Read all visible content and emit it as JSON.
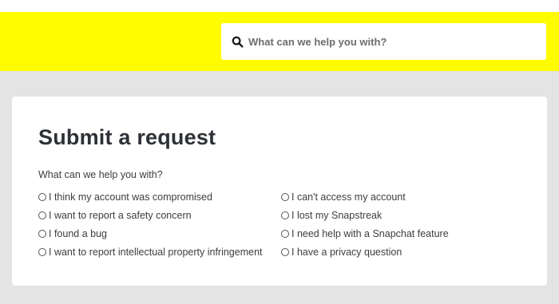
{
  "search": {
    "placeholder": "What can we help you with?",
    "icon": "search-icon"
  },
  "colors": {
    "header_yellow": "#fffc00",
    "page_background": "#e4e4e4",
    "title_text": "#2e3136"
  },
  "form": {
    "title": "Submit a request",
    "question": "What can we help you with?",
    "options": [
      {
        "label": "I think my account was compromised",
        "selected": false
      },
      {
        "label": "I can't access my account",
        "selected": false
      },
      {
        "label": "I want to report a safety concern",
        "selected": false
      },
      {
        "label": "I lost my Snapstreak",
        "selected": false
      },
      {
        "label": "I found a bug",
        "selected": false
      },
      {
        "label": "I need help with a Snapchat feature",
        "selected": false
      },
      {
        "label": "I want to report intellectual property infringement",
        "selected": false
      },
      {
        "label": "I have a privacy question",
        "selected": false
      }
    ]
  }
}
